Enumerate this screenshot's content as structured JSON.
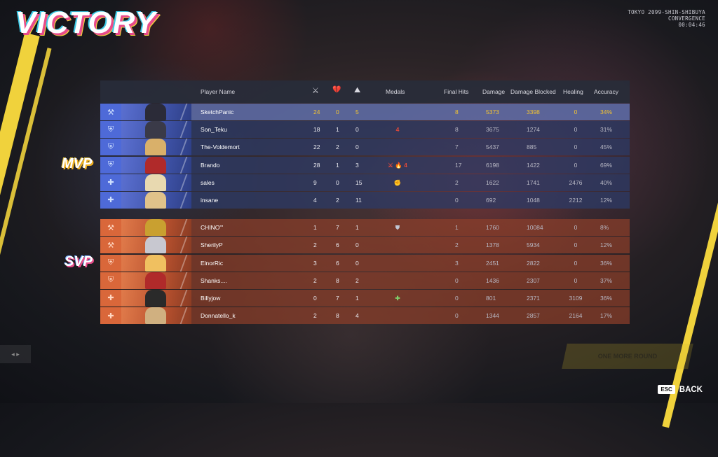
{
  "title": "VICTORY",
  "location": {
    "line1": "TOKYO 2099-SHIN-SHIBUYA",
    "line2": "CONVERGENCE",
    "time": "00:04:46"
  },
  "headers": {
    "player_name": "Player Name",
    "kills_icon": "⚔",
    "deaths_icon": "💔",
    "assists_icon": "⛰",
    "medals": "Medals",
    "final_hits": "Final Hits",
    "damage": "Damage",
    "damage_blocked": "Damage Blocked",
    "healing": "Healing",
    "accuracy": "Accuracy"
  },
  "badges": {
    "mvp": "MVP",
    "svp": "SVP"
  },
  "team_blue": [
    {
      "role_icon": "⚒",
      "name": "SketchPanic",
      "k": "24",
      "d": "0",
      "a": "5",
      "medals": "",
      "final_hits": "8",
      "damage": "5373",
      "blocked": "3398",
      "healing": "0",
      "accuracy": "34%",
      "highlight": true,
      "face": "#2b2b38"
    },
    {
      "role_icon": "⛨",
      "name": "Son_Teku",
      "k": "18",
      "d": "1",
      "a": "0",
      "medals": "4",
      "medal_class": "medal-red",
      "final_hits": "8",
      "damage": "3675",
      "blocked": "1274",
      "healing": "0",
      "accuracy": "31%",
      "face": "#3a3a48"
    },
    {
      "role_icon": "⛨",
      "name": "The-Voldemort",
      "k": "22",
      "d": "2",
      "a": "0",
      "medals": "",
      "final_hits": "7",
      "damage": "5437",
      "blocked": "885",
      "healing": "0",
      "accuracy": "45%",
      "face": "#d9b06a"
    },
    {
      "role_icon": "⛨",
      "name": "Brando",
      "k": "28",
      "d": "1",
      "a": "3",
      "medals": "⚔ 🔥 4",
      "medal_class": "medal-red",
      "final_hits": "17",
      "damage": "6198",
      "blocked": "1422",
      "healing": "0",
      "accuracy": "69%",
      "face": "#b02a2a"
    },
    {
      "role_icon": "✚",
      "name": "sales",
      "k": "9",
      "d": "0",
      "a": "15",
      "medals": "✊",
      "medal_class": "medal-gold",
      "final_hits": "2",
      "damage": "1622",
      "blocked": "1741",
      "healing": "2476",
      "accuracy": "40%",
      "face": "#e8d9b0"
    },
    {
      "role_icon": "✚",
      "name": "insane",
      "k": "4",
      "d": "2",
      "a": "11",
      "medals": "",
      "final_hits": "0",
      "damage": "692",
      "blocked": "1048",
      "healing": "2212",
      "accuracy": "12%",
      "face": "#e0c28a"
    }
  ],
  "team_red": [
    {
      "role_icon": "⚒",
      "name": "CHINO'''",
      "k": "1",
      "d": "7",
      "a": "1",
      "medals": "⛊",
      "medal_class": "medal-gray",
      "final_hits": "1",
      "damage": "1760",
      "blocked": "10084",
      "healing": "0",
      "accuracy": "8%",
      "face": "#c9a030"
    },
    {
      "role_icon": "⚒",
      "name": "SherilyP",
      "k": "2",
      "d": "6",
      "a": "0",
      "medals": "",
      "final_hits": "2",
      "damage": "1378",
      "blocked": "5934",
      "healing": "0",
      "accuracy": "12%",
      "face": "#c8c8d0"
    },
    {
      "role_icon": "⛨",
      "name": "ElnorRic",
      "k": "3",
      "d": "6",
      "a": "0",
      "medals": "",
      "final_hits": "3",
      "damage": "2451",
      "blocked": "2822",
      "healing": "0",
      "accuracy": "36%",
      "face": "#f0c060"
    },
    {
      "role_icon": "⛨",
      "name": "Shanks....",
      "k": "2",
      "d": "8",
      "a": "2",
      "medals": "",
      "final_hits": "0",
      "damage": "1436",
      "blocked": "2307",
      "healing": "0",
      "accuracy": "37%",
      "face": "#b02a2a"
    },
    {
      "role_icon": "✚",
      "name": "Billyjow",
      "k": "0",
      "d": "7",
      "a": "1",
      "medals": "✚",
      "medal_class": "medal-green",
      "final_hits": "0",
      "damage": "801",
      "blocked": "2371",
      "healing": "3109",
      "accuracy": "36%",
      "face": "#2a2a2a"
    },
    {
      "role_icon": "✚",
      "name": "Donnatello_k",
      "k": "2",
      "d": "8",
      "a": "4",
      "medals": "",
      "final_hits": "0",
      "damage": "1344",
      "blocked": "2857",
      "healing": "2164",
      "accuracy": "17%",
      "face": "#d0b080"
    }
  ],
  "footer": {
    "esc_key": "ESC",
    "back_label": "BACK",
    "faded_button": "ONE MORE ROUND"
  }
}
